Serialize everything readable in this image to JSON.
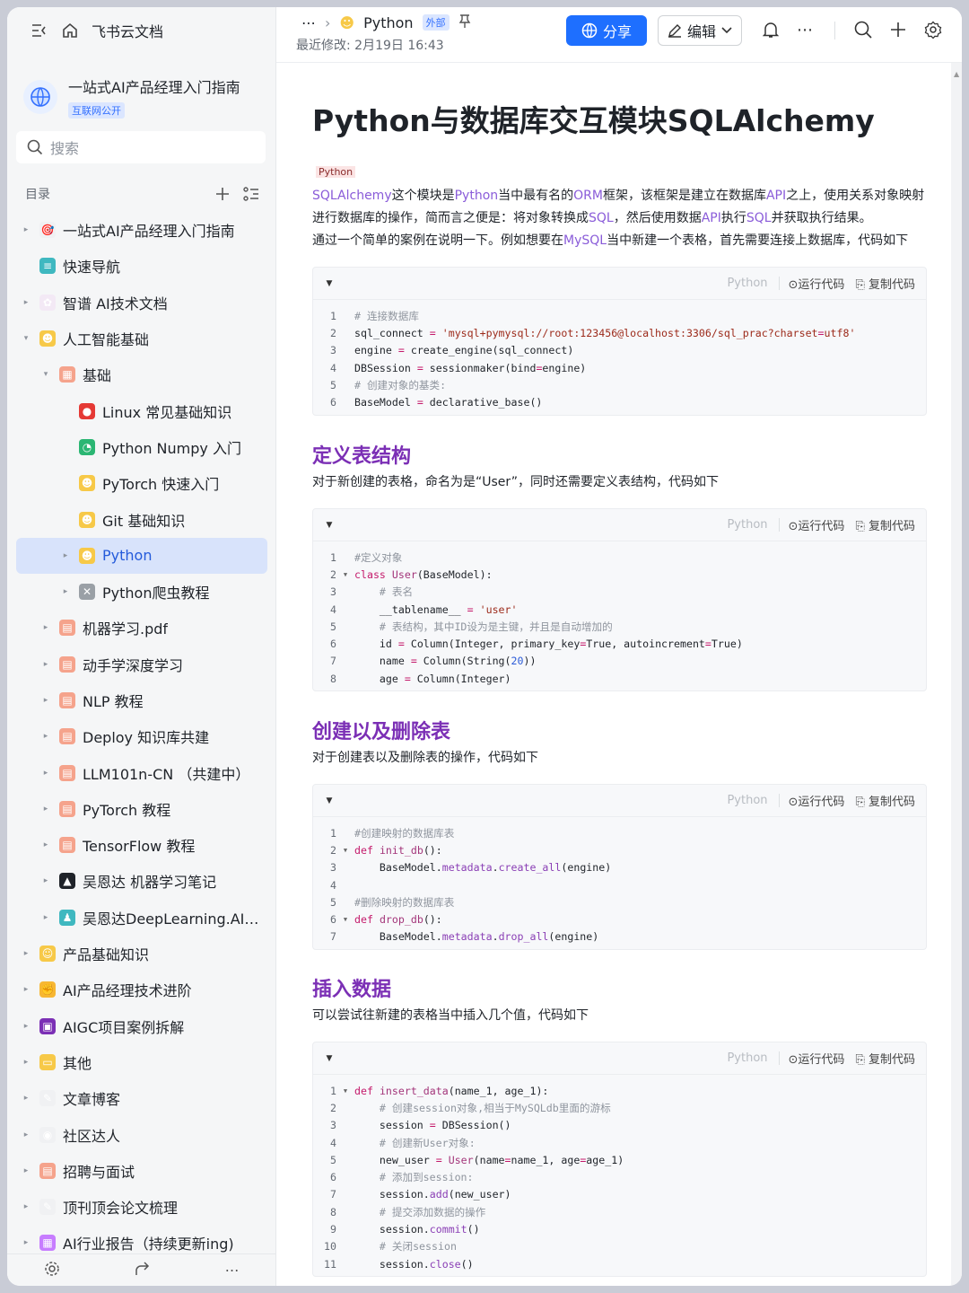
{
  "sidebar": {
    "app_name": "飞书云文档",
    "wiki_title": "一站式AI产品经理入门指南",
    "wiki_badge": "互联网公开",
    "search_placeholder": "搜索",
    "toc_label": "目录",
    "items": [
      {
        "label": "一站式AI产品经理入门指南",
        "level": 0,
        "arrow": "▸",
        "color": "#f0f1f3",
        "glyph": "🎯"
      },
      {
        "label": "快速导航",
        "level": 0,
        "arrow": "",
        "color": "#3fb8c0",
        "glyph": "≡"
      },
      {
        "label": "智谱 AI技术文档",
        "level": 0,
        "arrow": "▸",
        "color": "#f3e9f5",
        "glyph": "✿"
      },
      {
        "label": "人工智能基础",
        "level": 0,
        "arrow": "▾",
        "color": "#f7c948",
        "glyph": "☻"
      },
      {
        "label": "基础",
        "level": 1,
        "arrow": "▾",
        "color": "#f5a38c",
        "glyph": "▦"
      },
      {
        "label": "Linux 常见基础知识",
        "level": 2,
        "arrow": "",
        "color": "#e53935",
        "glyph": "●"
      },
      {
        "label": "Python Numpy 入门",
        "level": 2,
        "arrow": "",
        "color": "#2bb673",
        "glyph": "◔"
      },
      {
        "label": "PyTorch 快速入门",
        "level": 2,
        "arrow": "",
        "color": "#f7c948",
        "glyph": "☻"
      },
      {
        "label": "Git 基础知识",
        "level": 2,
        "arrow": "",
        "color": "#f7c948",
        "glyph": "☻"
      },
      {
        "label": "Python",
        "level": 2,
        "arrow": "▸",
        "color": "#f7c948",
        "glyph": "☻",
        "active": true
      },
      {
        "label": "Python爬虫教程",
        "level": 2,
        "arrow": "▸",
        "color": "#9aa0a6",
        "glyph": "✕"
      },
      {
        "label": "机器学习.pdf",
        "level": 1,
        "arrow": "▸",
        "color": "#f5a38c",
        "glyph": "▤"
      },
      {
        "label": "动手学深度学习",
        "level": 1,
        "arrow": "▸",
        "color": "#f5a38c",
        "glyph": "▤"
      },
      {
        "label": "NLP 教程",
        "level": 1,
        "arrow": "▸",
        "color": "#f5a38c",
        "glyph": "▤"
      },
      {
        "label": "Deploy 知识库共建",
        "level": 1,
        "arrow": "▸",
        "color": "#f5a38c",
        "glyph": "▤"
      },
      {
        "label": "LLM101n-CN （共建中）",
        "level": 1,
        "arrow": "▸",
        "color": "#f5a38c",
        "glyph": "▤"
      },
      {
        "label": "PyTorch 教程",
        "level": 1,
        "arrow": "▸",
        "color": "#f5a38c",
        "glyph": "▤"
      },
      {
        "label": "TensorFlow 教程",
        "level": 1,
        "arrow": "▸",
        "color": "#f5a38c",
        "glyph": "▤"
      },
      {
        "label": "吴恩达 机器学习笔记",
        "level": 1,
        "arrow": "▸",
        "color": "#1f2329",
        "glyph": "▲"
      },
      {
        "label": "吴恩达DeepLearning.AI课程笔记",
        "level": 1,
        "arrow": "▸",
        "color": "#3fb8c0",
        "glyph": "♟"
      },
      {
        "label": "产品基础知识",
        "level": 0,
        "arrow": "▸",
        "color": "#f7c948",
        "glyph": "☺"
      },
      {
        "label": "AI产品经理技术进阶",
        "level": 0,
        "arrow": "▸",
        "color": "#f7b733",
        "glyph": "✊"
      },
      {
        "label": "AIGC项目案例拆解",
        "level": 0,
        "arrow": "▸",
        "color": "#7b2fb5",
        "glyph": "▣"
      },
      {
        "label": "其他",
        "level": 0,
        "arrow": "▸",
        "color": "#f7c948",
        "glyph": "▭"
      },
      {
        "label": "文章博客",
        "level": 0,
        "arrow": "▸",
        "color": "#f0f1f3",
        "glyph": "✎"
      },
      {
        "label": "社区达人",
        "level": 0,
        "arrow": "▸",
        "color": "#f0f1f3",
        "glyph": "◉"
      },
      {
        "label": "招聘与面试",
        "level": 0,
        "arrow": "▸",
        "color": "#f5a38c",
        "glyph": "▤"
      },
      {
        "label": "顶刊顶会论文梳理",
        "level": 0,
        "arrow": "▸",
        "color": "#f0f1f3",
        "glyph": "✎"
      },
      {
        "label": "AI行业报告（持续更新ing)",
        "level": 0,
        "arrow": "▸",
        "color": "#c77dff",
        "glyph": "▦"
      }
    ]
  },
  "header": {
    "crumb_label": "Python",
    "crumb_badge": "外部",
    "last_modified": "最近修改: 2月19日 16:43",
    "share_label": "分享",
    "edit_label": "编辑"
  },
  "doc": {
    "title": "Python与数据库交互模块SQLAlchemy",
    "tag": "Python",
    "intro_1_parts": [
      "SQLAlchemy",
      "这个模块是",
      "Python",
      "当中最有名的",
      "ORM",
      "框架，该框架是建立在数据库",
      "API",
      "之上，使用关系对象映射进行数据库的操作，简而言之便是：将对象转换成",
      "SQL",
      "，然后使用数据",
      "API",
      "执行",
      "SQL",
      "并获取执行结果。"
    ],
    "intro_2_parts": [
      "通过一个简单的案例在说明一下。例如想要在",
      "MySQL",
      "当中新建一个表格，首先需要连接上数据库，代码如下"
    ],
    "sections": [
      {
        "heading": "",
        "desc": ""
      },
      {
        "heading": "定义表结构",
        "desc": "对于新创建的表格，命名为是“User”，同时还需要定义表结构，代码如下"
      },
      {
        "heading": "创建以及删除表",
        "desc": "对于创建表以及删除表的操作，代码如下"
      },
      {
        "heading": "插入数据",
        "desc": "可以尝试往新建的表格当中插入几个值，代码如下"
      }
    ],
    "code_toolbar": {
      "lang": "Python",
      "run": "运行代码",
      "copy": "复制代码"
    },
    "code_blocks": [
      [
        "# 连接数据库",
        "sql_connect = 'mysql+pymysql://root:123456@localhost:3306/sql_prac?charset=utf8'",
        "engine = create_engine(sql_connect)",
        "DBSession = sessionmaker(bind=engine)",
        "# 创建对象的基类:",
        "BaseModel = declarative_base()"
      ],
      [
        "#定义对象",
        "class User(BaseModel):",
        "    # 表名",
        "    __tablename__ = 'user'",
        "    # 表结构，其中ID设为是主键，并且是自动增加的",
        "    id = Column(Integer, primary_key=True, autoincrement=True)",
        "    name = Column(String(20))",
        "    age = Column(Integer)"
      ],
      [
        "#创建映射的数据库表",
        "def init_db():",
        "    BaseModel.metadata.create_all(engine)",
        "",
        "#删除映射的数据库表",
        "def drop_db():",
        "    BaseModel.metadata.drop_all(engine)"
      ],
      [
        "def insert_data(name_1, age_1):",
        "    # 创建session对象,相当于MySQLdb里面的游标",
        "    session = DBSession()",
        "    # 创建新User对象:",
        "    new_user = User(name=name_1, age=age_1)",
        "    # 添加到session:",
        "    session.add(new_user)",
        "    # 提交添加数据的操作",
        "    session.commit()",
        "    # 关闭session",
        "    session.close()"
      ]
    ],
    "fold_lines": [
      [],
      [
        2
      ],
      [
        2,
        6
      ],
      [
        1
      ]
    ]
  },
  "colors": {
    "accent": "#1e6fff",
    "heading": "#7b2fb5",
    "link_highlight": "#8a5cd9",
    "keyword": "#c41a6b",
    "string": "#9c2a1a"
  }
}
